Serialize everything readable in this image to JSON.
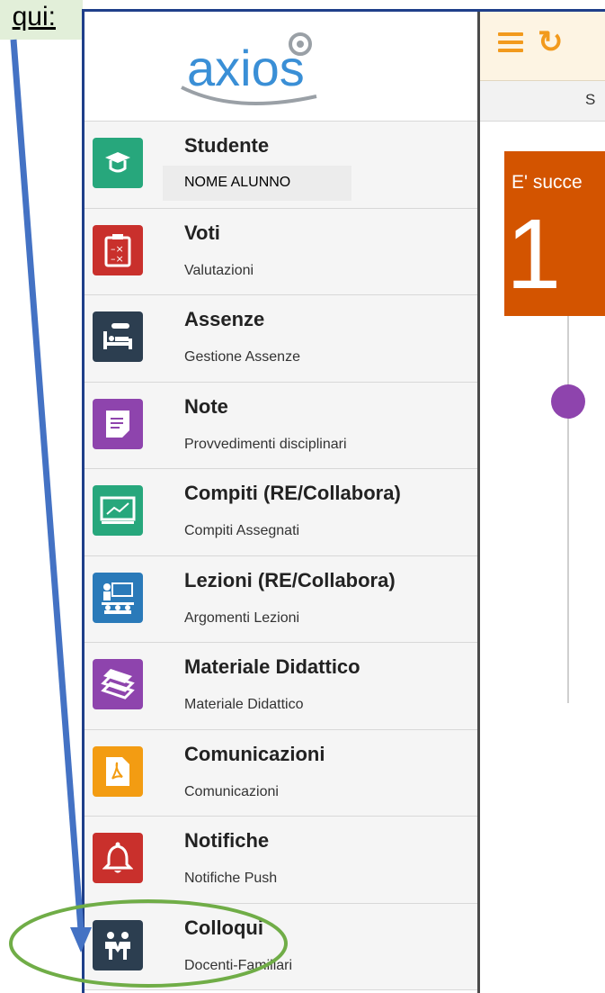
{
  "callout": {
    "text": "qui:"
  },
  "logo": {
    "text": "axios"
  },
  "menu": {
    "items": [
      {
        "title": "Studente",
        "subtitle": "NOME ALUNNO",
        "icon": "graduate-icon",
        "color": "#27a77c"
      },
      {
        "title": "Voti",
        "subtitle": "Valutazioni",
        "icon": "clipboard-icon",
        "color": "#c9302c"
      },
      {
        "title": "Assenze",
        "subtitle": "Gestione Assenze",
        "icon": "bed-thermometer-icon",
        "color": "#2c3e50"
      },
      {
        "title": "Note",
        "subtitle": "Provvedimenti disciplinari",
        "icon": "note-icon",
        "color": "#8e44ad"
      },
      {
        "title": "Compiti (RE/Collabora)",
        "subtitle": "Compiti Assegnati",
        "icon": "blackboard-icon",
        "color": "#27a77c"
      },
      {
        "title": "Lezioni (RE/Collabora)",
        "subtitle": "Argomenti Lezioni",
        "icon": "classroom-icon",
        "color": "#2a7ab9"
      },
      {
        "title": "Materiale Didattico",
        "subtitle": "Materiale Didattico",
        "icon": "books-icon",
        "color": "#8e44ad"
      },
      {
        "title": "Comunicazioni",
        "subtitle": "Comunicazioni",
        "icon": "pdf-file-icon",
        "color": "#f39c12"
      },
      {
        "title": "Notifiche",
        "subtitle": "Notifiche Push",
        "icon": "bell-icon",
        "color": "#c9302c"
      },
      {
        "title": "Colloqui",
        "subtitle": "Docenti-Familiari",
        "icon": "meeting-people-icon",
        "color": "#2c3e50"
      }
    ]
  },
  "main": {
    "subbar_text": "S",
    "card_text": "E' succe",
    "card_number": "1"
  },
  "colors": {
    "accent": "#f29a1d",
    "card": "#d35400",
    "dot": "#8e44ad",
    "arrow": "#4472c4",
    "ellipse": "#70ad47"
  }
}
